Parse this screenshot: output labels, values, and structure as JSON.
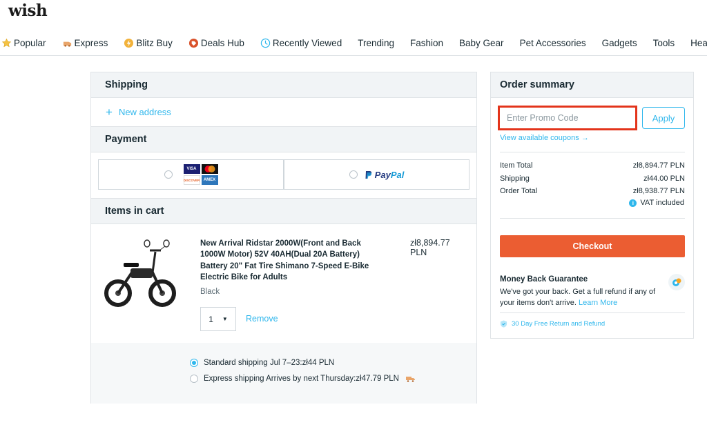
{
  "header": {
    "logo": "wish"
  },
  "nav": {
    "items": [
      {
        "label": "Popular",
        "icon": "star-icon"
      },
      {
        "label": "Express",
        "icon": "express-icon"
      },
      {
        "label": "Blitz Buy",
        "icon": "blitz-buy-icon"
      },
      {
        "label": "Deals Hub",
        "icon": "deals-hub-icon"
      },
      {
        "label": "Recently Viewed",
        "icon": "clock-icon"
      },
      {
        "label": "Trending"
      },
      {
        "label": "Fashion"
      },
      {
        "label": "Baby Gear"
      },
      {
        "label": "Pet Accessories"
      },
      {
        "label": "Gadgets"
      },
      {
        "label": "Tools"
      },
      {
        "label": "Health"
      }
    ]
  },
  "shipping": {
    "title": "Shipping",
    "new_address": "New address"
  },
  "payment": {
    "title": "Payment",
    "card_logos": [
      "VISA",
      "MC",
      "DISCOVER",
      "AMEX"
    ],
    "paypal_pay": "Pay",
    "paypal_pal": "Pal"
  },
  "cart": {
    "title": "Items in cart",
    "item": {
      "name": "New Arrival Ridstar 2000W(Front and Back 1000W Motor) 52V 40AH(Dual 20A Battery) Battery 20\" Fat Tire Shimano 7-Speed E-Bike Electric Bike for Adults",
      "price": "zł8,894.77 PLN",
      "variant": "Black",
      "quantity": "1",
      "remove": "Remove"
    },
    "shipping_options": [
      {
        "label": "Standard shipping Jul 7–23:zł44 PLN",
        "selected": true
      },
      {
        "label": "Express shipping Arrives by next Thursday:zł47.79 PLN",
        "selected": false
      }
    ]
  },
  "summary": {
    "title": "Order summary",
    "promo_placeholder": "Enter Promo Code",
    "apply": "Apply",
    "view_coupons": "View available coupons →",
    "item_total_label": "Item Total",
    "item_total": "zł8,894.77 PLN",
    "shipping_label": "Shipping",
    "shipping": "zł44.00 PLN",
    "order_total_label": "Order Total",
    "order_total": "zł8,938.77 PLN",
    "vat": "VAT included",
    "checkout": "Checkout",
    "mbg_title": "Money Back Guarantee",
    "mbg_text": "We've got your back. Get a full refund if any of your items don't arrive.",
    "learn_more": "Learn More",
    "return_policy": "30 Day Free Return and Refund"
  },
  "colors": {
    "accent": "#2fb7ec",
    "checkout": "#eb5d32",
    "promo_highlight": "#e3341b"
  }
}
